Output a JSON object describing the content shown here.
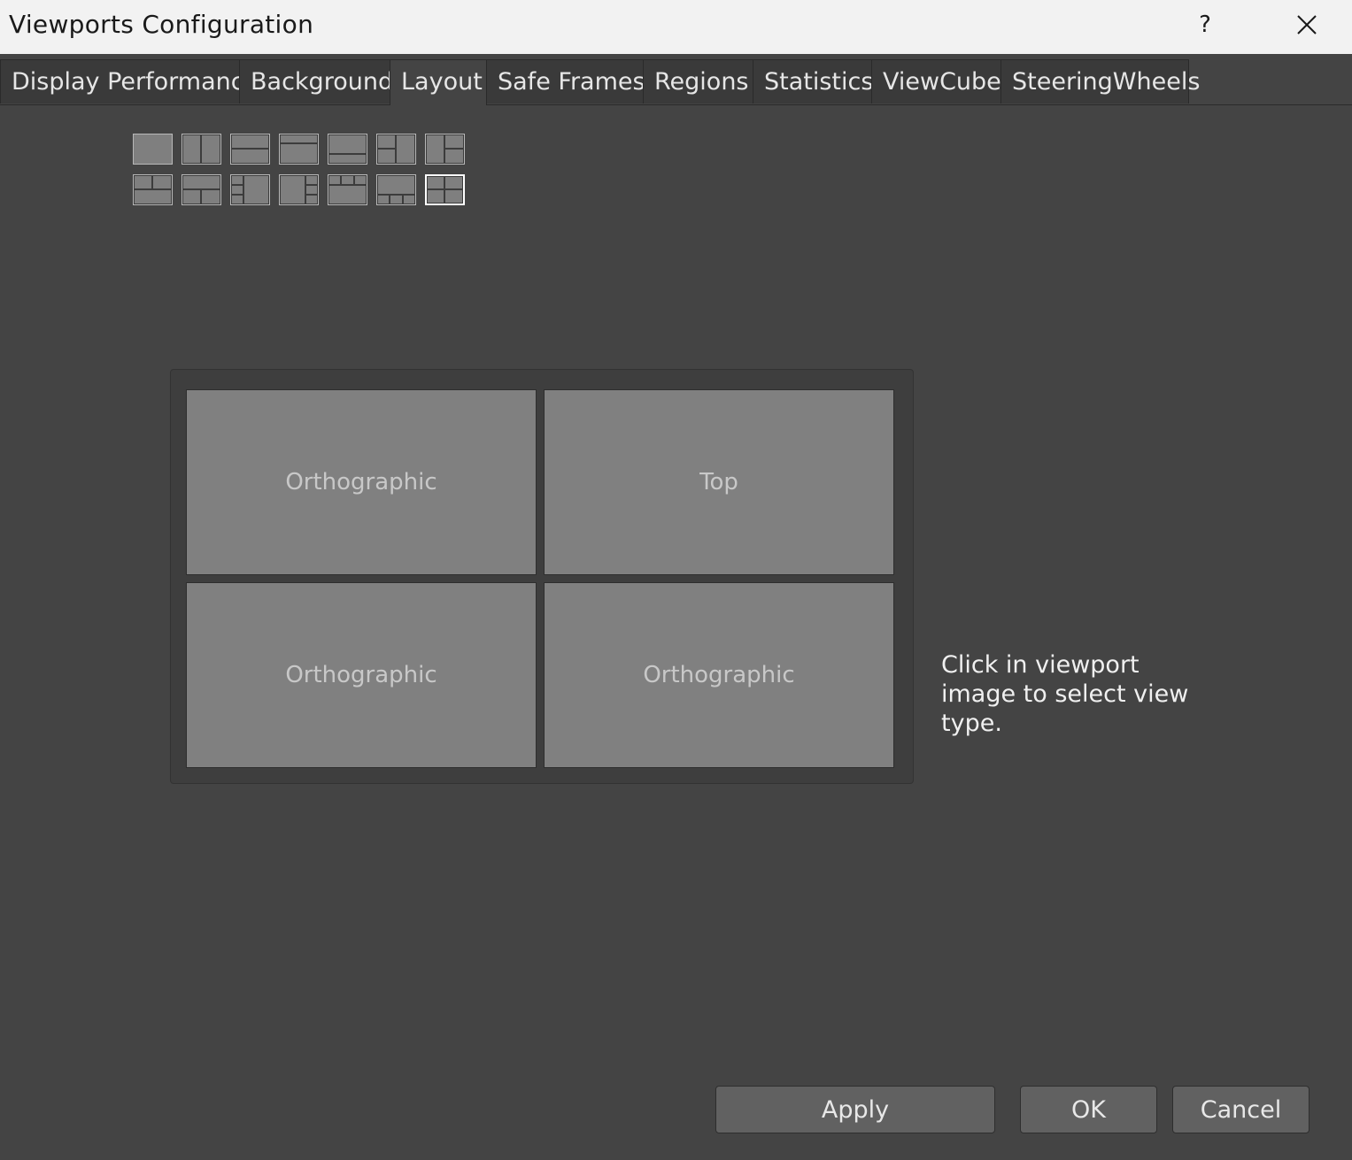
{
  "window": {
    "title": "Viewports Configuration",
    "help_label": "?"
  },
  "tabs": [
    {
      "label": "Display Performance",
      "active": false
    },
    {
      "label": "Background",
      "active": false
    },
    {
      "label": "Layout",
      "active": true
    },
    {
      "label": "Safe Frames",
      "active": false
    },
    {
      "label": "Regions",
      "active": false
    },
    {
      "label": "Statistics",
      "active": false
    },
    {
      "label": "ViewCube",
      "active": false
    },
    {
      "label": "SteeringWheels",
      "active": false
    }
  ],
  "layouts": {
    "selected_index": 13,
    "count": 14
  },
  "viewports": [
    {
      "label": "Orthographic"
    },
    {
      "label": "Top"
    },
    {
      "label": "Orthographic"
    },
    {
      "label": "Orthographic"
    }
  ],
  "hint": "Click in viewport image to select view type.",
  "buttons": {
    "apply": "Apply",
    "ok": "OK",
    "cancel": "Cancel"
  },
  "colors": {
    "background": "#444444",
    "titlebar": "#f2f2f2",
    "viewport_fill": "#808080"
  }
}
